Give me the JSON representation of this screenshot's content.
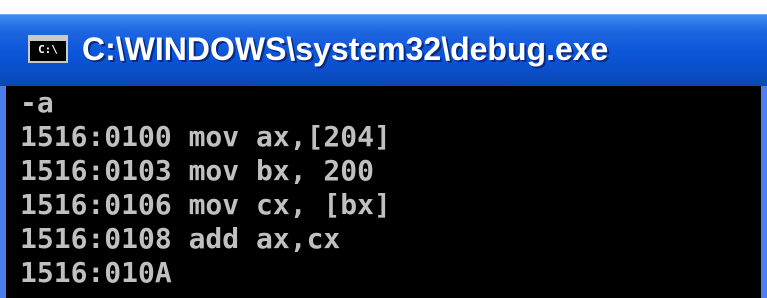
{
  "window": {
    "title": "C:\\WINDOWS\\system32\\debug.exe",
    "icon_label": "C:\\",
    "icon": "console-icon"
  },
  "console": {
    "lines": [
      "-a",
      "1516:0100 mov ax,[204]",
      "1516:0103 mov bx, 200",
      "1516:0106 mov cx, [bx]",
      "1516:0108 add ax,cx",
      "1516:010A"
    ]
  },
  "colors": {
    "titlebar": "#0a55d8",
    "console_bg": "#000000",
    "console_text": "#c0c0c0"
  }
}
